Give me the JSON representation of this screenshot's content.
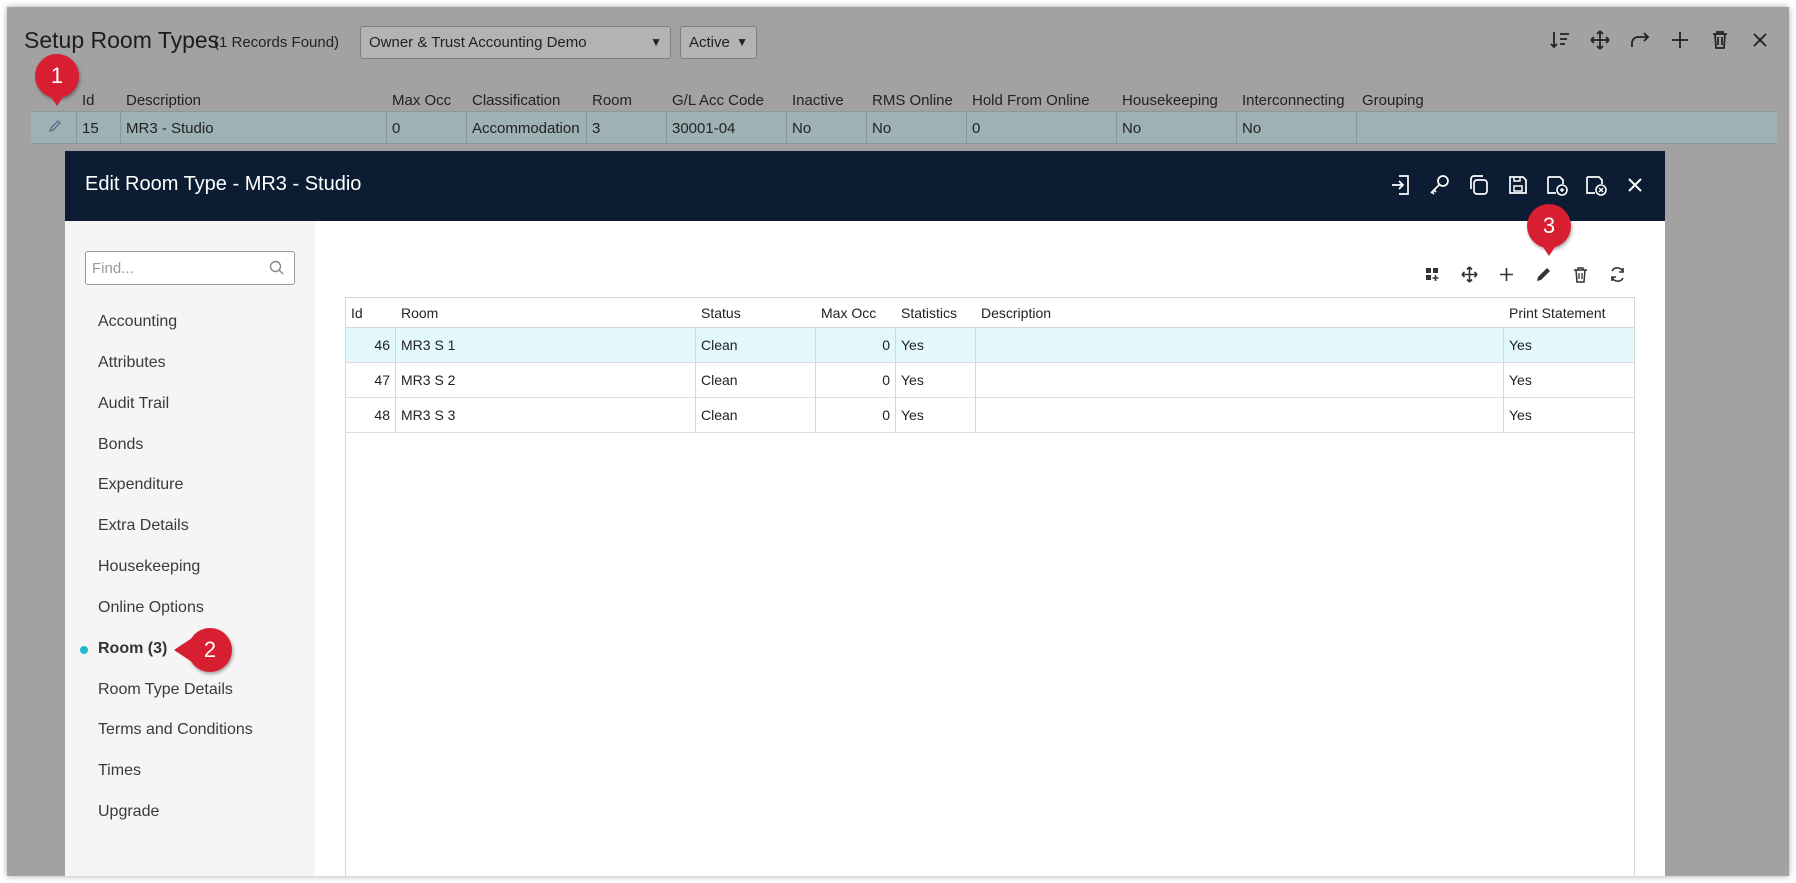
{
  "background": {
    "title": "Setup Room Types",
    "count": "(1 Records Found)",
    "property_select": "Owner & Trust Accounting Demo",
    "status_select": "Active",
    "toolbar_icons": [
      "sort-icon",
      "move-icon",
      "redo-icon",
      "add-icon",
      "delete-icon",
      "close-icon"
    ],
    "columns": [
      "Id",
      "Description",
      "Max Occ",
      "Classification",
      "Room",
      "G/L Acc Code",
      "Inactive",
      "RMS Online",
      "Hold From Online",
      "Housekeeping",
      "Interconnecting",
      "Grouping"
    ],
    "row": {
      "id": "15",
      "description": "MR3 - Studio",
      "max_occ": "0",
      "classification": "Accommodation",
      "room": "3",
      "gl_acc_code": "30001-04",
      "inactive": "No",
      "rms_online": "No",
      "hold_from_online": "0",
      "housekeeping": "No",
      "interconnecting": "No",
      "grouping": ""
    }
  },
  "modal": {
    "title": "Edit Room Type - MR3 - Studio",
    "toolbar_icons": [
      "sign-in-icon",
      "key-icon",
      "copy-icon",
      "save-icon",
      "save-copy-icon",
      "save-close-icon",
      "close-icon"
    ],
    "search_placeholder": "Find...",
    "nav": [
      "Accounting",
      "Attributes",
      "Audit Trail",
      "Bonds",
      "Expenditure",
      "Extra Details",
      "Housekeeping",
      "Online Options",
      "Room (3)",
      "Room Type Details",
      "Terms and Conditions",
      "Times",
      "Upgrade"
    ],
    "active_nav": "Room (3)",
    "grid_tools": [
      "grid-options-icon",
      "move-icon",
      "add-icon",
      "edit-icon",
      "delete-icon",
      "refresh-icon"
    ],
    "grid": {
      "columns": [
        "Id",
        "Room",
        "Status",
        "Max Occ",
        "Statistics",
        "Description",
        "Print Statement"
      ],
      "rows": [
        {
          "id": "46",
          "room": "MR3 S 1",
          "status": "Clean",
          "max_occ": "0",
          "statistics": "Yes",
          "description": "",
          "print_statement": "Yes"
        },
        {
          "id": "47",
          "room": "MR3 S 2",
          "status": "Clean",
          "max_occ": "0",
          "statistics": "Yes",
          "description": "",
          "print_statement": "Yes"
        },
        {
          "id": "48",
          "room": "MR3 S 3",
          "status": "Clean",
          "max_occ": "0",
          "statistics": "Yes",
          "description": "",
          "print_statement": "Yes"
        }
      ]
    }
  },
  "callouts": [
    "1",
    "2",
    "3"
  ],
  "colors": {
    "header_navy": "#0c1c33",
    "selected_row": "#e3f8fc",
    "active_dot": "#22b8cf",
    "callout_red": "#d81f31"
  }
}
